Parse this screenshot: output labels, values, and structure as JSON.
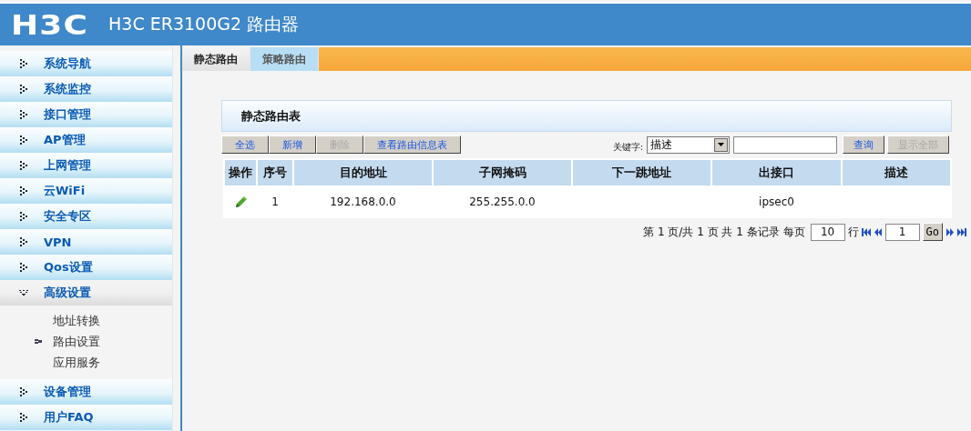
{
  "header": {
    "logo": "H3C",
    "title": "H3C ER3100G2 路由器"
  },
  "sidebar": {
    "items": [
      {
        "label": "系统导航",
        "expanded": false
      },
      {
        "label": "系统监控",
        "expanded": false
      },
      {
        "label": "接口管理",
        "expanded": false
      },
      {
        "label": "AP管理",
        "expanded": false
      },
      {
        "label": "上网管理",
        "expanded": false
      },
      {
        "label": "云WiFi",
        "expanded": false
      },
      {
        "label": "安全专区",
        "expanded": false
      },
      {
        "label": "VPN",
        "expanded": false
      },
      {
        "label": "Qos设置",
        "expanded": false
      },
      {
        "label": "高级设置",
        "expanded": true,
        "children": [
          {
            "label": "地址转换",
            "selected": false
          },
          {
            "label": "路由设置",
            "selected": true
          },
          {
            "label": "应用服务",
            "selected": false
          }
        ]
      },
      {
        "label": "设备管理",
        "expanded": false
      },
      {
        "label": "用户FAQ",
        "expanded": false
      }
    ]
  },
  "tabs": [
    {
      "label": "静态路由",
      "selected": true
    },
    {
      "label": "策略路由",
      "selected": false
    }
  ],
  "panel": {
    "title": "静态路由表",
    "buttons": [
      {
        "label": "全选",
        "disabled": false
      },
      {
        "label": "新增",
        "disabled": false
      },
      {
        "label": "删除",
        "disabled": true
      },
      {
        "label": "查看路由信息表",
        "disabled": false
      }
    ],
    "keyword_label": "关键字:",
    "keyword_select": "描述",
    "search_buttons": [
      {
        "label": "查询",
        "disabled": false
      },
      {
        "label": "显示全部",
        "disabled": true
      }
    ],
    "table": {
      "columns": [
        "操作",
        "序号",
        "目的地址",
        "子网掩码",
        "下一跳地址",
        "出接口",
        "描述"
      ],
      "rows": [
        {
          "cells": [
            "",
            "1",
            "192.168.0.0",
            "255.255.0.0",
            "",
            "ipsec0",
            ""
          ]
        }
      ]
    },
    "pagination": {
      "summary": "第 1 页/共 1 页 共 1 条记录 每页",
      "per_page": "10",
      "rows_label": "行",
      "page": "1",
      "go": "Go"
    }
  }
}
